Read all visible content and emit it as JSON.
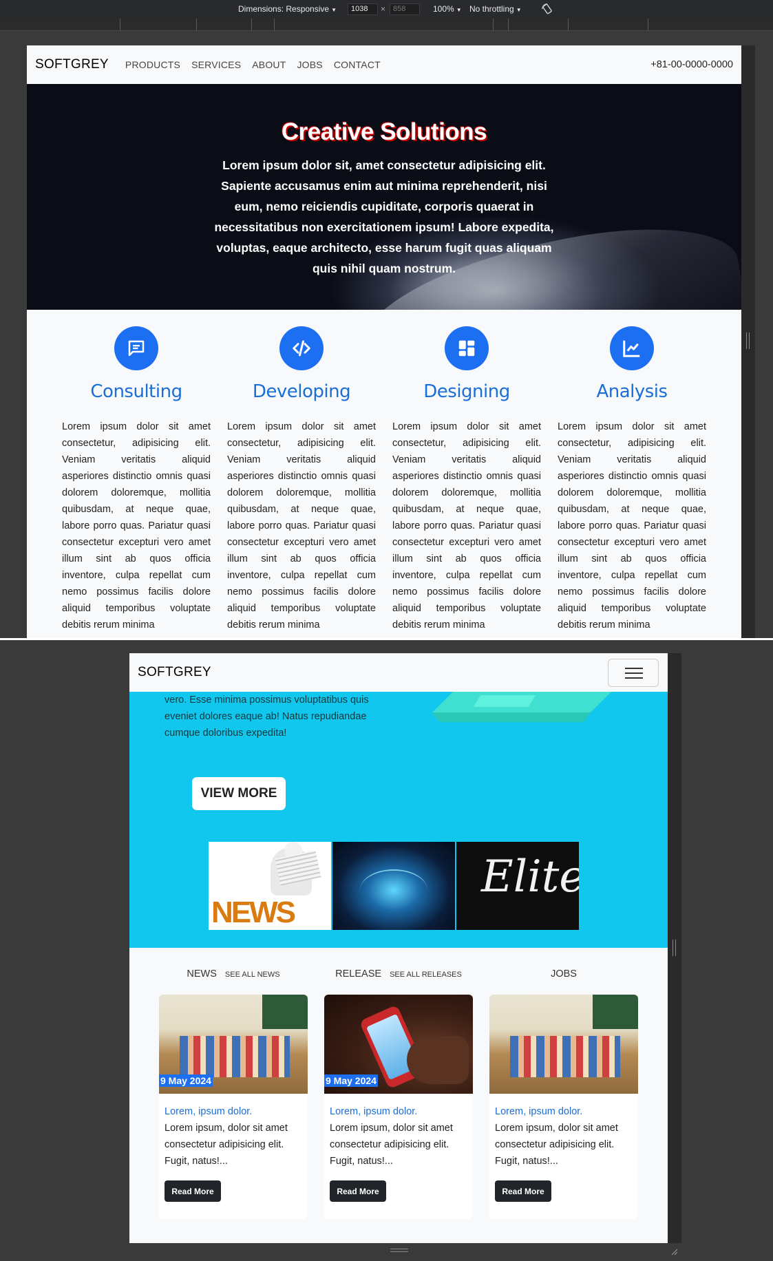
{
  "devtools": {
    "dimensions_label": "Dimensions: Responsive",
    "width_value": "1038",
    "times_symbol": "×",
    "height_placeholder": "858",
    "zoom": "100%",
    "throttling": "No throttling"
  },
  "site": {
    "brand": "SOFTGREY",
    "nav_links": [
      "PRODUCTS",
      "SERVICES",
      "ABOUT",
      "JOBS",
      "CONTACT"
    ],
    "phone": "+81-00-0000-0000"
  },
  "hero": {
    "title": "Creative Solutions",
    "text": "Lorem ipsum dolor sit, amet consectetur adipisicing elit. Sapiente accusamus enim aut minima reprehenderit, nisi eum, nemo reiciendis cupiditate, corporis quaerat in necessitatibus non exercitationem ipsum! Labore expedita, voluptas, eaque architecto, esse harum fugit quas aliquam quis nihil quam nostrum."
  },
  "services": [
    {
      "title": "Consulting",
      "icon": "chat-icon",
      "text": "Lorem ipsum dolor sit amet consectetur, adipisicing elit. Veniam veritatis aliquid asperiores distinctio omnis quasi dolorem doloremque, mollitia quibusdam, at neque quae, labore porro quas. Pariatur quasi consectetur excepturi vero amet illum sint ab quos officia inventore, culpa repellat cum nemo possimus facilis dolore aliquid temporibus voluptate debitis rerum minima"
    },
    {
      "title": "Developing",
      "icon": "code-icon",
      "text": "Lorem ipsum dolor sit amet consectetur, adipisicing elit. Veniam veritatis aliquid asperiores distinctio omnis quasi dolorem doloremque, mollitia quibusdam, at neque quae, labore porro quas. Pariatur quasi consectetur excepturi vero amet illum sint ab quos officia inventore, culpa repellat cum nemo possimus facilis dolore aliquid temporibus voluptate debitis rerum minima"
    },
    {
      "title": "Designing",
      "icon": "grid-layout-icon",
      "text": "Lorem ipsum dolor sit amet consectetur, adipisicing elit. Veniam veritatis aliquid asperiores distinctio omnis quasi dolorem doloremque, mollitia quibusdam, at neque quae, labore porro quas. Pariatur quasi consectetur excepturi vero amet illum sint ab quos officia inventore, culpa repellat cum nemo possimus facilis dolore aliquid temporibus voluptate debitis rerum minima"
    },
    {
      "title": "Analysis",
      "icon": "line-chart-icon",
      "text": "Lorem ipsum dolor sit amet consectetur, adipisicing elit. Veniam veritatis aliquid asperiores distinctio omnis quasi dolorem doloremque, mollitia quibusdam, at neque quae, labore porro quas. Pariatur quasi consectetur excepturi vero amet illum sint ab quos officia inventore, culpa repellat cum nemo possimus facilis dolore aliquid temporibus voluptate debitis rerum minima"
    }
  ],
  "promo": {
    "intro_text": "vero. Esse minima possimus voluptatibus quis eveniet dolores eaque ab! Natus repudiandae cumque doloribus expedita!",
    "view_more": "VIEW MORE",
    "thumbnails": [
      {
        "alt": "news-figure-image",
        "caption": "NEWS"
      },
      {
        "alt": "glowing-book-image",
        "caption": ""
      },
      {
        "alt": "elite-script-image",
        "caption": "Elite"
      }
    ]
  },
  "feeds": [
    {
      "heading": "NEWS",
      "link": "SEE ALL NEWS",
      "date": "9 May 2024",
      "title": "Lorem, ipsum dolor.",
      "text": "Lorem ipsum, dolor sit amet consectetur adipisicing elit. Fugit, natus!...",
      "button": "Read More",
      "image": "classroom"
    },
    {
      "heading": "RELEASE",
      "link": "SEE ALL RELEASES",
      "date": "9 May 2024",
      "title": "Lorem, ipsum dolor.",
      "text": "Lorem ipsum, dolor sit amet consectetur adipisicing elit. Fugit, natus!...",
      "button": "Read More",
      "image": "phone"
    },
    {
      "heading": "JOBS",
      "link": "",
      "date": "",
      "title": "Lorem, ipsum dolor.",
      "text": "Lorem ipsum, dolor sit amet consectetur adipisicing elit. Fugit, natus!...",
      "button": "Read More",
      "image": "classroom"
    }
  ],
  "colors": {
    "accent": "#1d6ff2",
    "cyan": "#12c7ed",
    "dark_button": "#212529"
  }
}
